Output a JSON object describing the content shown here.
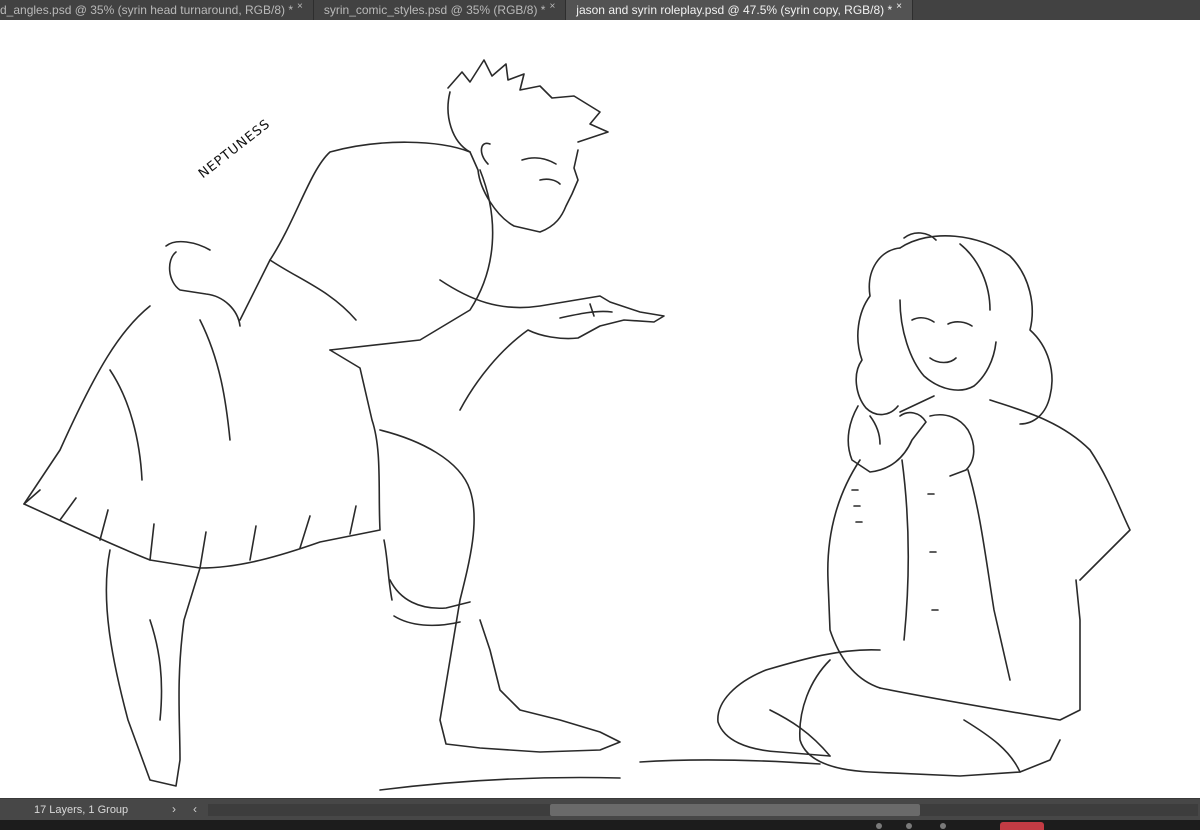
{
  "tabs": [
    {
      "label": "d_angles.psd @ 35% (syrin head turnaround, RGB/8) *",
      "close": "×",
      "active": false
    },
    {
      "label": "syrin_comic_styles.psd @ 35% (RGB/8) *",
      "close": "×",
      "active": false
    },
    {
      "label": "jason and syrin roleplay.psd @ 47.5% (syrin copy, RGB/8) *",
      "close": "×",
      "active": true
    }
  ],
  "canvas": {
    "signature": "NEPTUNESS",
    "background_color": "#ffffff",
    "line_color": "#2a2a2a"
  },
  "status": {
    "layers_text": "17 Layers, 1 Group",
    "expand_icon": "chevron-right-icon",
    "scroll_left_icon": "chevron-left-icon"
  },
  "colors": {
    "tabbar_bg": "#424242",
    "active_tab_bg": "#535353",
    "statusbar_bg": "#474747"
  }
}
